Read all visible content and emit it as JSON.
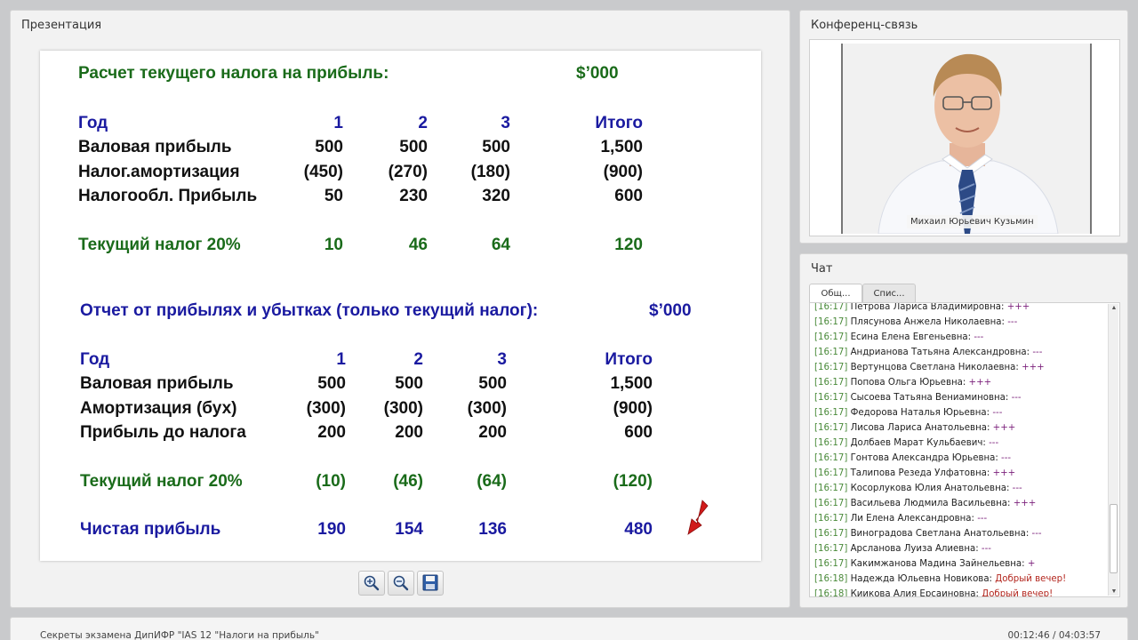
{
  "presentation": {
    "title": "Презентация",
    "slide": {
      "section1": {
        "title": "Расчет текущего налога на прибыль:",
        "unit": "$’000",
        "header": [
          "Год",
          "1",
          "2",
          "3",
          "Итого"
        ],
        "rows": [
          [
            "Валовая прибыль",
            "500",
            "500",
            "500",
            "1,500"
          ],
          [
            "Налог.амортизация",
            "(450)",
            "(270)",
            "(180)",
            "(900)"
          ],
          [
            "Налогообл. Прибыль",
            "50",
            "230",
            "320",
            "600"
          ]
        ],
        "tax_row": [
          "Текущий налог 20%",
          "10",
          "46",
          "64",
          "120"
        ]
      },
      "section2": {
        "title": "Отчет от прибылях и убытках (только текущий налог):",
        "unit": "$’000",
        "header": [
          "Год",
          "1",
          "2",
          "3",
          "Итого"
        ],
        "rows": [
          [
            "Валовая прибыль",
            "500",
            "500",
            "500",
            "1,500"
          ],
          [
            "Амортизация (бух)",
            "(300)",
            "(300)",
            "(300)",
            "(900)"
          ],
          [
            "Прибыль до налога",
            "200",
            "200",
            "200",
            "600"
          ]
        ],
        "tax_row": [
          "Текущий налог 20%",
          "(10)",
          "(46)",
          "(64)",
          "(120)"
        ],
        "net_row": [
          "Чистая прибыль",
          "190",
          "154",
          "136",
          "480"
        ]
      }
    },
    "toolbar": {
      "icons": [
        "zoom-in-icon",
        "zoom-out-icon",
        "save-icon"
      ]
    }
  },
  "conference": {
    "title": "Конференц-связь",
    "presenter_name": "Михаил Юрьевич Кузьмин"
  },
  "chat": {
    "title": "Чат",
    "tabs": [
      "Общ...",
      "Спис..."
    ],
    "messages": [
      {
        "time": "[16:17]",
        "name": "Петрова Лариса Владимировна:",
        "text": "+++"
      },
      {
        "time": "[16:17]",
        "name": "Плясунова Анжела Николаевна:",
        "text": "---"
      },
      {
        "time": "[16:17]",
        "name": "Есина Елена Евгеньевна:",
        "text": "---"
      },
      {
        "time": "[16:17]",
        "name": "Андрианова Татьяна Александровна:",
        "text": "---"
      },
      {
        "time": "[16:17]",
        "name": "Вертунцова Светлана Николаевна:",
        "text": "+++"
      },
      {
        "time": "[16:17]",
        "name": "Попова Ольга Юрьевна:",
        "text": "+++"
      },
      {
        "time": "[16:17]",
        "name": "Сысоева Татьяна Вениаминовна:",
        "text": "---"
      },
      {
        "time": "[16:17]",
        "name": "Федорова Наталья Юрьевна:",
        "text": "---"
      },
      {
        "time": "[16:17]",
        "name": "Лисова Лариса Анатольевна:",
        "text": "+++"
      },
      {
        "time": "[16:17]",
        "name": "Долбаев Марат Кульбаевич:",
        "text": "---"
      },
      {
        "time": "[16:17]",
        "name": "Гонтова Александра Юрьевна:",
        "text": "---"
      },
      {
        "time": "[16:17]",
        "name": "Талипова Резеда Улфатовна:",
        "text": "+++"
      },
      {
        "time": "[16:17]",
        "name": "Косорлукова Юлия Анатольевна:",
        "text": "---"
      },
      {
        "time": "[16:17]",
        "name": "Васильева Людмила Васильевна:",
        "text": "+++"
      },
      {
        "time": "[16:17]",
        "name": "Ли Елена Александровна:",
        "text": "---"
      },
      {
        "time": "[16:17]",
        "name": "Виноградова Светлана Анатольевна:",
        "text": "---"
      },
      {
        "time": "[16:17]",
        "name": "Арсланова Луиза Алиевна:",
        "text": "---"
      },
      {
        "time": "[16:17]",
        "name": "Какимжанова Мадина Зайнельевна:",
        "text": "+"
      },
      {
        "time": "[16:18]",
        "name": "Надежда Юльевна Новикова:",
        "text": "Добрый вечер!"
      },
      {
        "time": "[16:18]",
        "name": "Киикова Алия Ерсаиновна:",
        "text": "Добрый вечер!"
      }
    ]
  },
  "footer": {
    "title": "Секреты экзамена ДипИФР \"IAS 12 \"Налоги на прибыль\"",
    "time": "00:12:46 / 04:03:57"
  },
  "colors": {
    "slide_green": "#1a6b1a",
    "slide_blue": "#1a1aa0",
    "pointer_red": "#d11a1a"
  }
}
